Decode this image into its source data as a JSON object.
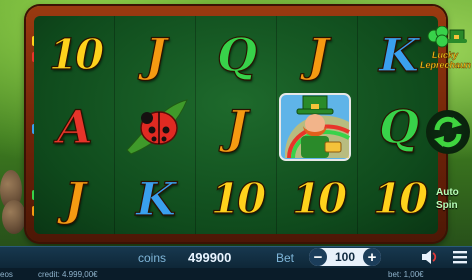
{
  "game": {
    "logo_text": "Lucky Leprechaun",
    "reels": [
      [
        {
          "symbol": "10",
          "color": "yellow"
        },
        {
          "symbol": "A",
          "color": "red"
        },
        {
          "symbol": "J",
          "color": "orange"
        }
      ],
      [
        {
          "symbol": "J",
          "color": "orange"
        },
        {
          "symbol": "ladybug",
          "color": "red"
        },
        {
          "symbol": "K",
          "color": "blue"
        }
      ],
      [
        {
          "symbol": "Q",
          "color": "green"
        },
        {
          "symbol": "J",
          "color": "orange"
        },
        {
          "symbol": "10",
          "color": "yellow"
        }
      ],
      [
        {
          "symbol": "J",
          "color": "orange"
        },
        {
          "symbol": "leprechaun",
          "color": "green"
        },
        {
          "symbol": "10",
          "color": "yellow"
        }
      ],
      [
        {
          "symbol": "K",
          "color": "blue"
        },
        {
          "symbol": "Q",
          "color": "green"
        },
        {
          "symbol": "10",
          "color": "yellow"
        }
      ]
    ],
    "auto_spin_label": "Auto Spin"
  },
  "bottom_bar": {
    "coins_label": "coins",
    "coins_value": "499900",
    "bet_label": "Bet",
    "bet_value": "100",
    "minus": "−",
    "plus": "+"
  },
  "status_bar": {
    "left_fragment": "eos",
    "credit": "credit: 4.999,00€",
    "bet": "bet: 1,00€"
  },
  "colors": {
    "frame": "#6b2208",
    "reel_bg": "#0f4a1c",
    "bar_bg": "#17384f"
  }
}
